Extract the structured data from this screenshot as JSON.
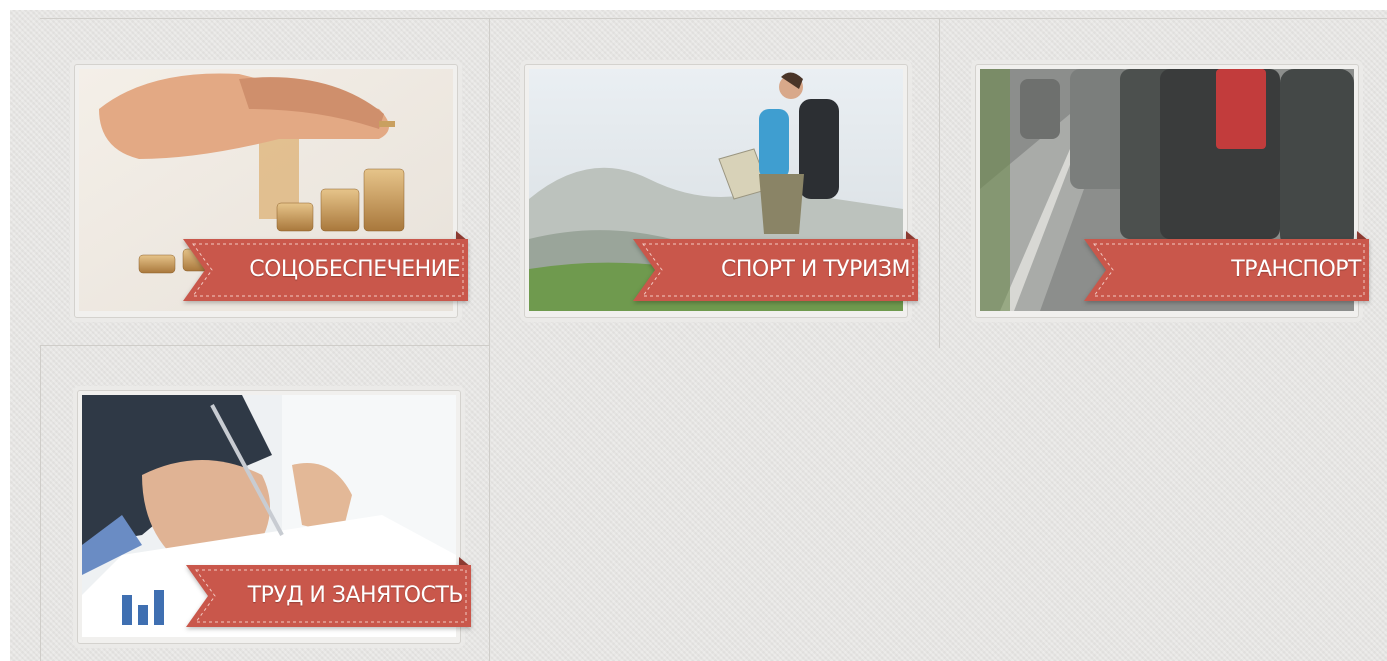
{
  "colors": {
    "ribbon": "#c9574b",
    "ribbon_dark": "#8c3a31",
    "ribbon_stitch": "#f2c9c2",
    "background": "#e6e5e3"
  },
  "categories": [
    {
      "label": "СОЦОБЕСПЕЧЕНИЕ",
      "image": "coins-hand-photo"
    },
    {
      "label": "СПОРТ И ТУРИЗМ",
      "image": "hiker-photo"
    },
    {
      "label": "ТРАНСПОРТ",
      "image": "traffic-jam-photo"
    },
    {
      "label": "ТРУД И ЗАНЯТОСТЬ",
      "image": "business-writing-photo"
    }
  ]
}
